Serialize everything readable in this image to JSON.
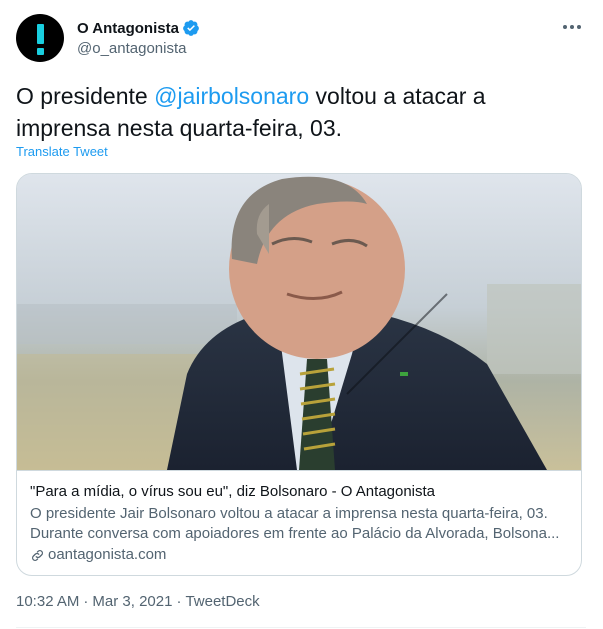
{
  "author": {
    "display_name": "O Antagonista",
    "handle": "@o_antagonista",
    "verified": true,
    "avatar_icon": "exclamation-mark-icon",
    "avatar_bg": "#000000",
    "avatar_fg": "#19cfe0"
  },
  "tweet": {
    "text_before": "O presidente ",
    "mention": "@jairbolsonaro",
    "text_after": " voltou a atacar a imprensa nesta quarta-feira, 03.",
    "translate_label": "Translate Tweet"
  },
  "card": {
    "title": "\"Para a mídia, o vírus sou eu\", diz Bolsonaro - O Antagonista",
    "description_line1": "O presidente Jair Bolsonaro voltou a atacar a imprensa nesta quarta-feira, 03.",
    "description_line2": "Durante conversa com apoiadores em frente ao Palácio da Alvorada, Bolsona...",
    "domain": "oantagonista.com"
  },
  "meta": {
    "time": "10:32 AM",
    "date": "Mar 3, 2021",
    "separator": "·",
    "source": "TweetDeck"
  },
  "colors": {
    "link": "#1d9bf0",
    "text": "#0f1419",
    "secondary": "#536471",
    "border": "#cfd9de"
  }
}
